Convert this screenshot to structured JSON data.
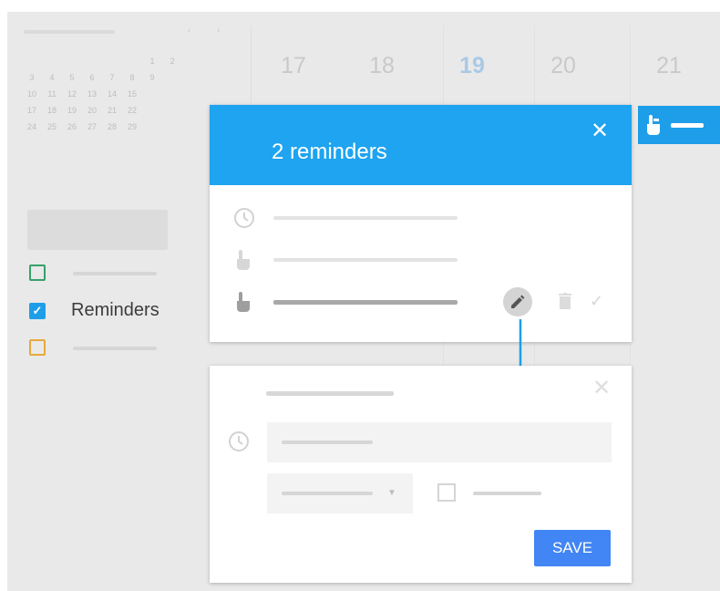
{
  "mini_calendar": {
    "nav": [
      "‹",
      "›"
    ],
    "rows": [
      [
        "",
        "",
        "",
        "",
        "",
        "",
        "1",
        "2"
      ],
      [
        "3",
        "4",
        "5",
        "6",
        "7",
        "8",
        "9",
        ""
      ],
      [
        "10",
        "11",
        "12",
        "13",
        "14",
        "15",
        "",
        ""
      ],
      [
        "17",
        "18",
        "19",
        "20",
        "21",
        "22",
        "",
        ""
      ],
      [
        "24",
        "25",
        "26",
        "27",
        "28",
        "29",
        "",
        ""
      ]
    ]
  },
  "calendars": {
    "reminders_label": "Reminders",
    "colors": {
      "first": "#37a06a",
      "reminders": "#1e9ee8",
      "third": "#e7a93a"
    }
  },
  "week": {
    "days": [
      "17",
      "18",
      "19",
      "20",
      "21"
    ],
    "today": "19"
  },
  "popup": {
    "title": "2 reminders",
    "close_glyph": "✕",
    "done_glyph": "✓"
  },
  "form": {
    "close_glyph": "✕",
    "select_caret": "▼",
    "save_label": "SAVE"
  },
  "colors": {
    "accent": "#1ea4f0",
    "save": "#4285f4",
    "background": "#e9e9e9"
  }
}
